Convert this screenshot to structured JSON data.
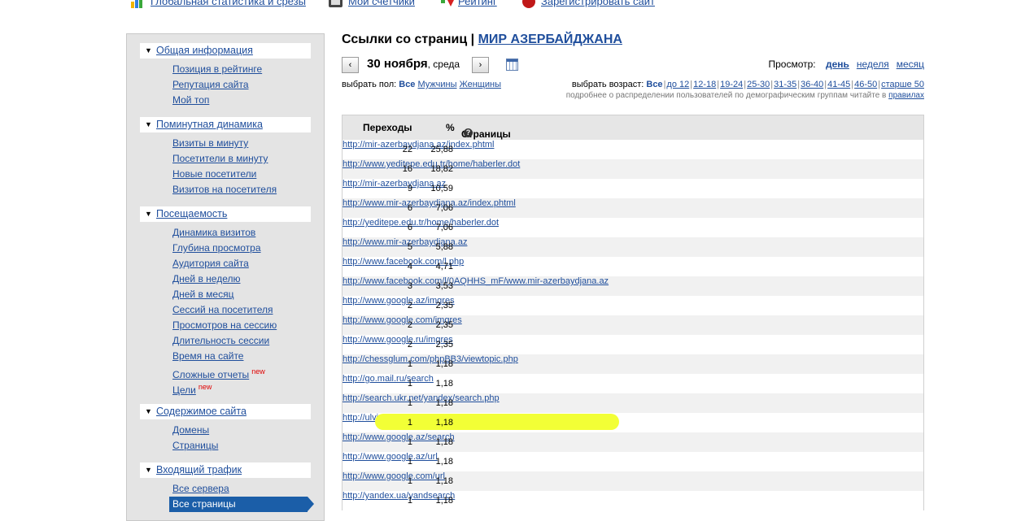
{
  "topnav": [
    {
      "label": "Глобальная статистика и срезы",
      "icon": "chart-icon"
    },
    {
      "label": "Мои счетчики",
      "icon": "counter-icon"
    },
    {
      "label": "Рейтинг",
      "icon": "rating-arrow-icon"
    },
    {
      "label": "Зарегистрировать сайт",
      "icon": "new-badge-icon"
    }
  ],
  "sidebar": [
    {
      "title": "Общая информация",
      "items": [
        {
          "label": "Позиция в рейтинге"
        },
        {
          "label": "Репутация сайта"
        },
        {
          "label": "Мой топ"
        }
      ]
    },
    {
      "title": "Поминутная динамика",
      "items": [
        {
          "label": "Визиты в минуту"
        },
        {
          "label": "Посетители в минуту"
        },
        {
          "label": "Новые посетители"
        },
        {
          "label": "Визитов на посетителя"
        }
      ]
    },
    {
      "title": "Посещаемость",
      "items": [
        {
          "label": "Динамика визитов"
        },
        {
          "label": "Глубина просмотра"
        },
        {
          "label": "Аудитория сайта"
        },
        {
          "label": "Дней в неделю"
        },
        {
          "label": "Дней в месяц"
        },
        {
          "label": "Сессий на посетителя"
        },
        {
          "label": "Просмотров на сессию"
        },
        {
          "label": "Длительность сессии"
        },
        {
          "label": "Время на сайте"
        },
        {
          "label": "Сложные отчеты",
          "badge": "new"
        },
        {
          "label": "Цели",
          "badge": "new"
        }
      ]
    },
    {
      "title": "Содержимое сайта",
      "items": [
        {
          "label": "Домены"
        },
        {
          "label": "Страницы"
        }
      ]
    },
    {
      "title": "Входящий трафик",
      "items": [
        {
          "label": "Все сервера"
        },
        {
          "label": "Все страницы",
          "active": true
        }
      ]
    }
  ],
  "main": {
    "title_prefix": "Ссылки со страниц | ",
    "site_name": "МИР АЗЕРБАЙДЖАНА",
    "prev": "‹",
    "next": "›",
    "date": "30 ноября",
    "weekday": ", среда",
    "view_label": "Просмотр:",
    "views": [
      {
        "label": "день",
        "current": true
      },
      {
        "label": "неделя"
      },
      {
        "label": "месяц"
      }
    ],
    "gender_label": "выбрать пол:",
    "genders": [
      {
        "label": "Все",
        "current": true
      },
      {
        "label": "Мужчины"
      },
      {
        "label": "Женщины"
      }
    ],
    "age_label": "выбрать возраст:",
    "ages": [
      {
        "label": "Все",
        "current": true
      },
      {
        "label": "до 12"
      },
      {
        "label": "12-18"
      },
      {
        "label": "19-24"
      },
      {
        "label": "25-30"
      },
      {
        "label": "31-35"
      },
      {
        "label": "36-40"
      },
      {
        "label": "41-45"
      },
      {
        "label": "46-50"
      },
      {
        "label": "старше 50"
      }
    ],
    "note_text": "подробнее о распределении пользователей по демографическим группам читайте в ",
    "note_link": "правилах"
  },
  "table": {
    "headers": {
      "visits": "Переходы",
      "percent": "%",
      "pages": "Страницы"
    },
    "rows": [
      {
        "visits": "22",
        "percent": "25,88",
        "url": "http://mir-azerbaydjana.az/index.phtml"
      },
      {
        "visits": "16",
        "percent": "18,82",
        "url": "http://www.yeditepe.edu.tr/home/haberler.dot"
      },
      {
        "visits": "9",
        "percent": "10,59",
        "url": "http://mir-azerbaydjana.az"
      },
      {
        "visits": "6",
        "percent": "7,06",
        "url": "http://www.mir-azerbaydjana.az/index.phtml"
      },
      {
        "visits": "6",
        "percent": "7,06",
        "url": "http://yeditepe.edu.tr/home/haberler.dot"
      },
      {
        "visits": "5",
        "percent": "5,88",
        "url": "http://www.mir-azerbaydjana.az"
      },
      {
        "visits": "4",
        "percent": "4,71",
        "url": "http://www.facebook.com/l.php"
      },
      {
        "visits": "3",
        "percent": "3,53",
        "url": "http://www.facebook.com/l/0AQHHS_mF/www.mir-azerbaydjana.az"
      },
      {
        "visits": "2",
        "percent": "2,35",
        "url": "http://www.google.az/imgres"
      },
      {
        "visits": "2",
        "percent": "2,35",
        "url": "http://www.google.com/imgres"
      },
      {
        "visits": "2",
        "percent": "2,35",
        "url": "http://www.google.ru/imgres"
      },
      {
        "visits": "1",
        "percent": "1,18",
        "url": "http://chessglum.com/phpBB3/viewtopic.php"
      },
      {
        "visits": "1",
        "percent": "1,18",
        "url": "http://go.mail.ru/search"
      },
      {
        "visits": "1",
        "percent": "1,18",
        "url": "http://search.ukr.net/yandex/search.php"
      },
      {
        "visits": "1",
        "percent": "1,18",
        "url": "http://ulviya-r.blogspot.com/search",
        "highlight": true
      },
      {
        "visits": "1",
        "percent": "1,18",
        "url": "http://www.google.az/search"
      },
      {
        "visits": "1",
        "percent": "1,18",
        "url": "http://www.google.az/url"
      },
      {
        "visits": "1",
        "percent": "1,18",
        "url": "http://www.google.com/url"
      },
      {
        "visits": "1",
        "percent": "1,18",
        "url": "http://yandex.ua/yandsearch"
      }
    ]
  },
  "colors": {
    "link": "#1f4e9c",
    "active_bg": "#1b5ea8",
    "highlight": "#f2ff36",
    "badge": "#e00000"
  }
}
